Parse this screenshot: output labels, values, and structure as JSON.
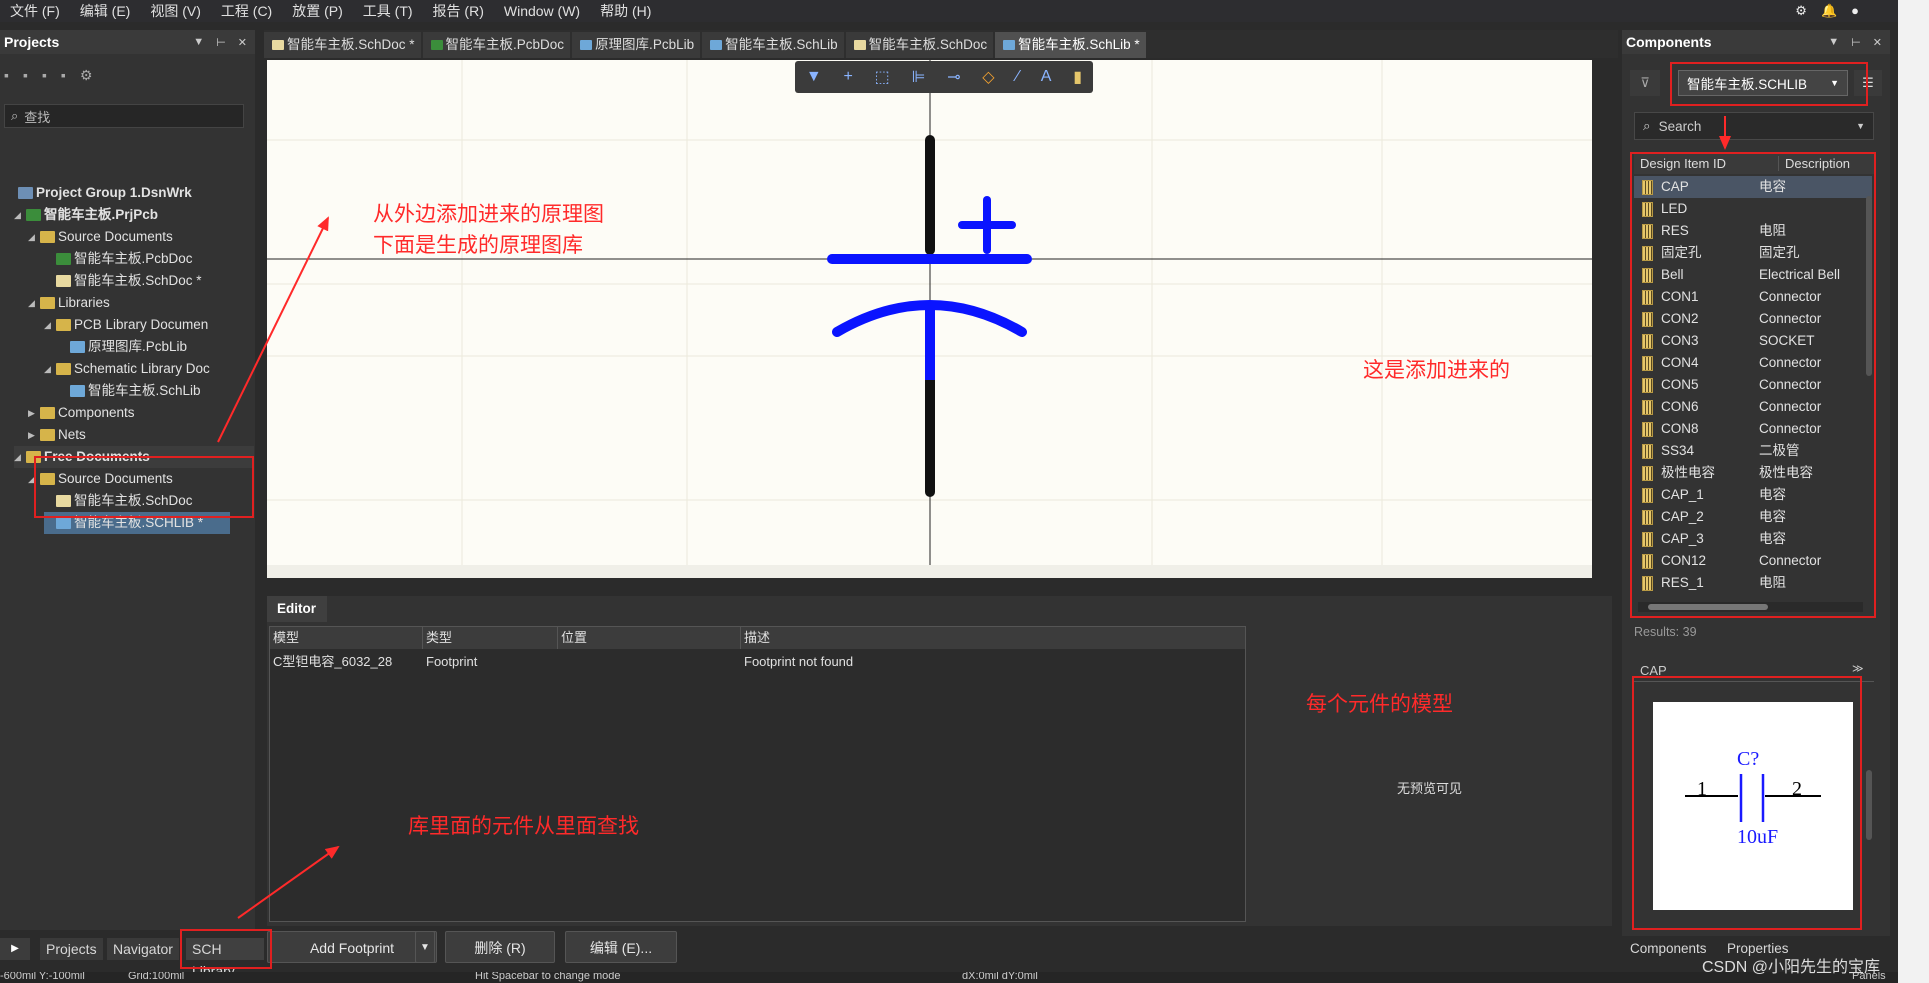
{
  "menu": [
    "文件 (F)",
    "编辑 (E)",
    "视图 (V)",
    "工程 (C)",
    "放置 (P)",
    "工具 (T)",
    "报告 (R)",
    "Window (W)",
    "帮助 (H)"
  ],
  "menu_right_icons": [
    "gear-icon",
    "bell-icon",
    "user-icon"
  ],
  "projects": {
    "title": "Projects",
    "search_placeholder": "查找",
    "tree": [
      {
        "label": "Project Group 1.DsnWrk",
        "icon": "proj",
        "bold": true
      },
      {
        "label": "智能车主板.PrjPcb",
        "icon": "pcb",
        "bold": true
      },
      {
        "label": "Source Documents",
        "icon": "folder",
        "bold": false
      },
      {
        "label": "智能车主板.PcbDoc",
        "icon": "pcb",
        "bold": false
      },
      {
        "label": "智能车主板.SchDoc *",
        "icon": "sch",
        "bold": false
      },
      {
        "label": "Libraries",
        "icon": "folder",
        "bold": false
      },
      {
        "label": "PCB Library Documen",
        "icon": "folder",
        "bold": false
      },
      {
        "label": "原理图库.PcbLib",
        "icon": "lib",
        "bold": false
      },
      {
        "label": "Schematic Library Doc",
        "icon": "folder",
        "bold": false
      },
      {
        "label": "智能车主板.SchLib",
        "icon": "lib",
        "bold": false
      },
      {
        "label": "Components",
        "icon": "folder",
        "bold": false
      },
      {
        "label": "Nets",
        "icon": "folder",
        "bold": false
      },
      {
        "label": "Free Documents",
        "icon": "folder",
        "bold": true
      },
      {
        "label": "Source Documents",
        "icon": "folder",
        "bold": false
      },
      {
        "label": "智能车主板.SchDoc",
        "icon": "sch",
        "bold": false
      },
      {
        "label": "智能车主板.SCHLIB *",
        "icon": "lib",
        "bold": false
      }
    ]
  },
  "tabs": [
    {
      "label": "智能车主板.SchDoc *",
      "icon": "sch",
      "active": false
    },
    {
      "label": "智能车主板.PcbDoc",
      "icon": "pcb",
      "active": false
    },
    {
      "label": "原理图库.PcbLib",
      "icon": "lib",
      "active": false
    },
    {
      "label": "智能车主板.SchLib",
      "icon": "lib",
      "active": false
    },
    {
      "label": "智能车主板.SchDoc",
      "icon": "sch",
      "active": false
    },
    {
      "label": "智能车主板.SchLib *",
      "icon": "lib",
      "active": true
    }
  ],
  "toolbar_icons": [
    "filter-icon",
    "plus-icon",
    "select-rect-icon",
    "align-icon",
    "pin-icon",
    "fill-icon",
    "line-icon",
    "text-icon",
    "part-icon"
  ],
  "editor": {
    "tab": "Editor",
    "columns": [
      "模型",
      "类型",
      "位置",
      "描述"
    ],
    "rows": [
      [
        "C型钽电容_6032_28",
        "Footprint",
        "",
        "Footprint not found"
      ]
    ],
    "no_preview": "无预览可见"
  },
  "bottom_tabs": [
    "Projects",
    "Navigator",
    "SCH Library"
  ],
  "buttons": {
    "add_footprint": "Add Footprint",
    "delete": "删除 (R)",
    "edit": "编辑 (E)..."
  },
  "status": {
    "coords": "-600mil Y:-100mil",
    "grid": "Grid:100mil",
    "hint": "Hit Spacebar to change mode",
    "delta": "dX:0mil dY:0mil",
    "panels": "Panels"
  },
  "components": {
    "title": "Components",
    "library": "智能车主板.SCHLIB",
    "search_placeholder": "Search",
    "col_id": "Design Item ID",
    "col_desc": "Description",
    "items": [
      {
        "id": "CAP",
        "desc": "电容"
      },
      {
        "id": "LED",
        "desc": ""
      },
      {
        "id": "RES",
        "desc": "电阻"
      },
      {
        "id": "固定孔",
        "desc": "固定孔"
      },
      {
        "id": "Bell",
        "desc": "Electrical Bell"
      },
      {
        "id": "CON1",
        "desc": "Connector"
      },
      {
        "id": "CON2",
        "desc": "Connector"
      },
      {
        "id": "CON3",
        "desc": "SOCKET"
      },
      {
        "id": "CON4",
        "desc": "Connector"
      },
      {
        "id": "CON5",
        "desc": "Connector"
      },
      {
        "id": "CON6",
        "desc": "Connector"
      },
      {
        "id": "CON8",
        "desc": "Connector"
      },
      {
        "id": "SS34",
        "desc": "二极管"
      },
      {
        "id": "极性电容",
        "desc": "极性电容"
      },
      {
        "id": "CAP_1",
        "desc": "电容"
      },
      {
        "id": "CAP_2",
        "desc": "电容"
      },
      {
        "id": "CAP_3",
        "desc": "电容"
      },
      {
        "id": "CON12",
        "desc": "Connector"
      },
      {
        "id": "RES_1",
        "desc": "电阻"
      }
    ],
    "results": "Results: 39",
    "preview_title": "CAP",
    "preview": {
      "designator": "C?",
      "pin1": "1",
      "pin2": "2",
      "value": "10uF"
    },
    "bottom_tabs": [
      "Components",
      "Properties"
    ]
  },
  "annotations": {
    "a1_line1": "从外边添加进来的原理图",
    "a1_line2": "下面是生成的原理图库",
    "a2": "这是添加进来的",
    "a3": "每个元件的模型",
    "a4": "库里面的元件从里面查找"
  },
  "watermark": "CSDN @小阳先生的宝库",
  "colors": {
    "accent_red": "#e02020",
    "symbol_blue": "#0a14ff",
    "panel": "#333333"
  }
}
